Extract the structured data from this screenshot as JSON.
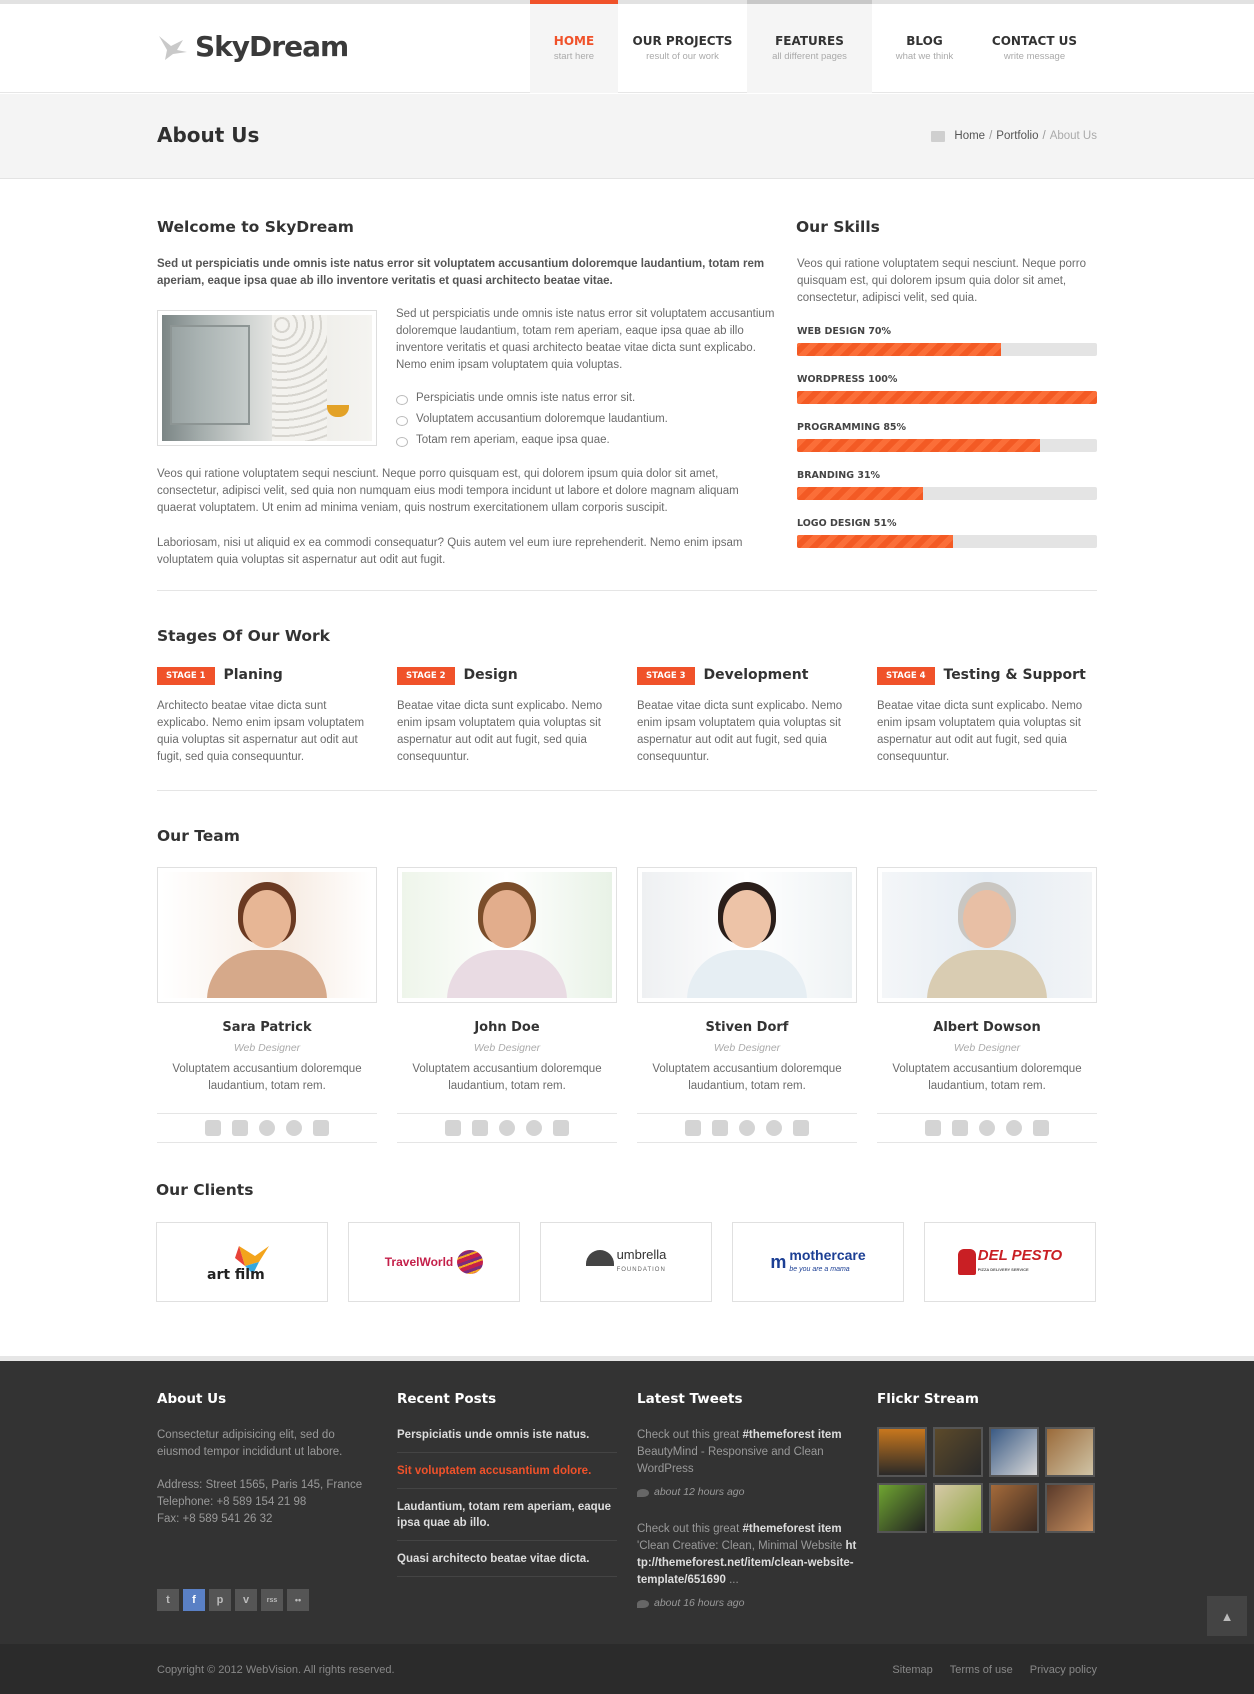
{
  "header": {
    "logo_text": "SkyDream",
    "nav": [
      {
        "label": "HOME",
        "sub": "start here"
      },
      {
        "label": "OUR PROJECTS",
        "sub": "result of our work"
      },
      {
        "label": "FEATURES",
        "sub": "all different pages"
      },
      {
        "label": "BLOG",
        "sub": "what we think"
      },
      {
        "label": "CONTACT US",
        "sub": "write message"
      }
    ]
  },
  "titlebar": {
    "title": "About Us",
    "breadcrumb": [
      "Home",
      "Portfolio",
      "About Us"
    ],
    "sep": "/"
  },
  "welcome": {
    "title": "Welcome to SkyDream",
    "lead": "Sed ut perspiciatis unde omnis iste natus error sit voluptatem accusantium doloremque laudantium, totam rem aperiam, eaque ipsa quae ab illo inventore veritatis et quasi architecto beatae vitae.",
    "side_text": "Sed ut perspiciatis unde omnis iste natus error sit voluptatem accusantium doloremque laudantium, totam rem aperiam, eaque ipsa quae ab illo inventore veritatis et quasi architecto beatae vitae dicta sunt explicabo. Nemo enim ipsam voluptatem quia voluptas.",
    "bullets": [
      "Perspiciatis unde omnis iste natus error sit.",
      "Voluptatem accusantium doloremque laudantium.",
      "Totam rem aperiam, eaque ipsa quae."
    ],
    "para1": "Veos qui ratione voluptatem sequi nesciunt. Neque porro quisquam est, qui dolorem ipsum quia dolor sit amet, consectetur, adipisci velit, sed quia non numquam eius modi tempora incidunt ut labore et dolore magnam aliquam quaerat voluptatem. Ut enim ad minima veniam, quis nostrum exercitationem ullam corporis suscipit.",
    "para2": "Laboriosam, nisi ut aliquid ex ea commodi consequatur? Quis autem vel eum iure reprehenderit. Nemo enim ipsam voluptatem quia voluptas sit aspernatur aut odit aut fugit."
  },
  "skills": {
    "title": "Our Skills",
    "intro": "Veos qui ratione voluptatem sequi nesciunt. Neque porro quisquam est, qui dolorem ipsum quia dolor sit amet, consectetur, adipisci velit, sed quia.",
    "items": [
      {
        "label": "WEB DESIGN 70%",
        "value": 0.68
      },
      {
        "label": "WORDPRESS 100%",
        "value": 1.0
      },
      {
        "label": "PROGRAMMING 85%",
        "value": 0.81
      },
      {
        "label": "BRANDING 31%",
        "value": 0.42
      },
      {
        "label": "LOGO DESIGN 51%",
        "value": 0.52
      }
    ]
  },
  "stages": {
    "title": "Stages Of Our Work",
    "items": [
      {
        "badge": "STAGE 1",
        "title": "Planing",
        "text": "Architecto beatae vitae dicta sunt explicabo. Nemo enim ipsam voluptatem quia voluptas sit aspernatur aut odit aut fugit, sed quia consequuntur."
      },
      {
        "badge": "STAGE 2",
        "title": "Design",
        "text": "Beatae vitae dicta sunt explicabo. Nemo enim ipsam voluptatem quia voluptas sit aspernatur aut odit aut fugit, sed quia consequuntur."
      },
      {
        "badge": "STAGE 3",
        "title": "Development",
        "text": "Beatae vitae dicta sunt explicabo. Nemo enim ipsam voluptatem quia voluptas sit aspernatur aut odit aut fugit, sed quia consequuntur."
      },
      {
        "badge": "STAGE 4",
        "title": "Testing & Support",
        "text": "Beatae vitae dicta sunt explicabo. Nemo enim ipsam voluptatem quia voluptas sit aspernatur aut odit aut fugit, sed quia consequuntur."
      }
    ]
  },
  "team": {
    "title": "Our Team",
    "members": [
      {
        "name": "Sara Patrick",
        "role": "Web Designer",
        "desc": "Voluptatem accusantium doloremque laudantium, totam rem."
      },
      {
        "name": "John Doe",
        "role": "Web Designer",
        "desc": "Voluptatem accusantium doloremque laudantium, totam rem."
      },
      {
        "name": "Stiven Dorf",
        "role": "Web Designer",
        "desc": "Voluptatem accusantium doloremque laudantium, totam rem."
      },
      {
        "name": "Albert Dowson",
        "role": "Web Designer",
        "desc": "Voluptatem accusantium doloremque laudantium, totam rem."
      }
    ],
    "social_icons": [
      "facebook-icon",
      "twitter-icon",
      "dribbble-icon",
      "skype-icon",
      "mail-icon"
    ]
  },
  "clients": {
    "title": "Our Clients",
    "logos": [
      {
        "name": "art film"
      },
      {
        "name": "TravelWorld"
      },
      {
        "name": "umbrella",
        "sub": "FOUNDATION"
      },
      {
        "name": "mothercare",
        "sub": "be you are a mama"
      },
      {
        "name": "DEL PESTO",
        "sub": "PIZZA DELIVERY SERVICE"
      }
    ]
  },
  "footer": {
    "about": {
      "title": "About Us",
      "text": "Consectetur adipisicing elit, sed do eiusmod tempor incididunt ut labore.",
      "address": "Address: Street 1565, Paris 145, France",
      "telephone": "Telephone: +8 589 154 21 98",
      "fax": "Fax: +8 589 541 26 32",
      "social": [
        "t",
        "f",
        "p",
        "v",
        "rss",
        "••"
      ]
    },
    "posts": {
      "title": "Recent Posts",
      "items": [
        "Perspiciatis unde omnis iste natus.",
        "Sit voluptatem accusantium dolore.",
        "Laudantium, totam rem aperiam, eaque ipsa quae ab illo.",
        "Quasi architecto beatae vitae dicta."
      ]
    },
    "tweets": {
      "title": "Latest Tweets",
      "items": [
        {
          "pre": "Check out this great ",
          "tag": "#themeforest item",
          "post": " BeautyMind - Responsive and Clean WordPress",
          "ago": "about 12 hours ago"
        },
        {
          "pre": "Check out this great ",
          "tag": "#themeforest item",
          "post": " 'Clean Creative: Clean, Minimal Website ",
          "link": "http://themeforest.net/item/clean-website-template/651690",
          "tail": " ...",
          "ago": "about 16 hours ago"
        }
      ]
    },
    "flickr": {
      "title": "Flickr Stream"
    }
  },
  "bottom": {
    "copyright": "Copyright © 2012 WebVision. All rights reserved.",
    "links": [
      "Sitemap",
      "Terms of use",
      "Privacy policy"
    ]
  },
  "colors": {
    "accent": "#f0522a"
  }
}
